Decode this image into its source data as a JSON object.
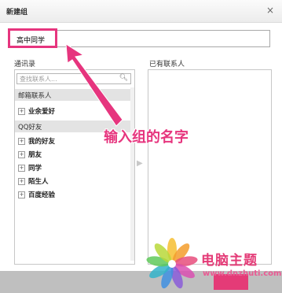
{
  "dialog": {
    "title": "新建组",
    "close_glyph": "×"
  },
  "group_name": {
    "value": "高中同学"
  },
  "contacts": {
    "heading": "通讯录",
    "search_placeholder": "查找联系人...",
    "search_icon": "magnifier-icon",
    "sections": [
      {
        "label": "邮箱联系人",
        "items": [
          {
            "expander": "+",
            "label": "业余爱好"
          }
        ]
      },
      {
        "label": "QQ好友",
        "items": [
          {
            "expander": "+",
            "label": "我的好友"
          },
          {
            "expander": "+",
            "label": "朋友"
          },
          {
            "expander": "+",
            "label": "同学"
          },
          {
            "expander": "+",
            "label": "陌生人"
          },
          {
            "expander": "+",
            "label": "百度经验"
          }
        ]
      }
    ]
  },
  "selected": {
    "heading": "已有联系人"
  },
  "transfer_arrow": "▶",
  "annotation": {
    "text": "输入组的名字",
    "color": "#e6357e"
  },
  "watermark": {
    "title": "电脑主题",
    "url": "www.dnzhuti.com"
  }
}
